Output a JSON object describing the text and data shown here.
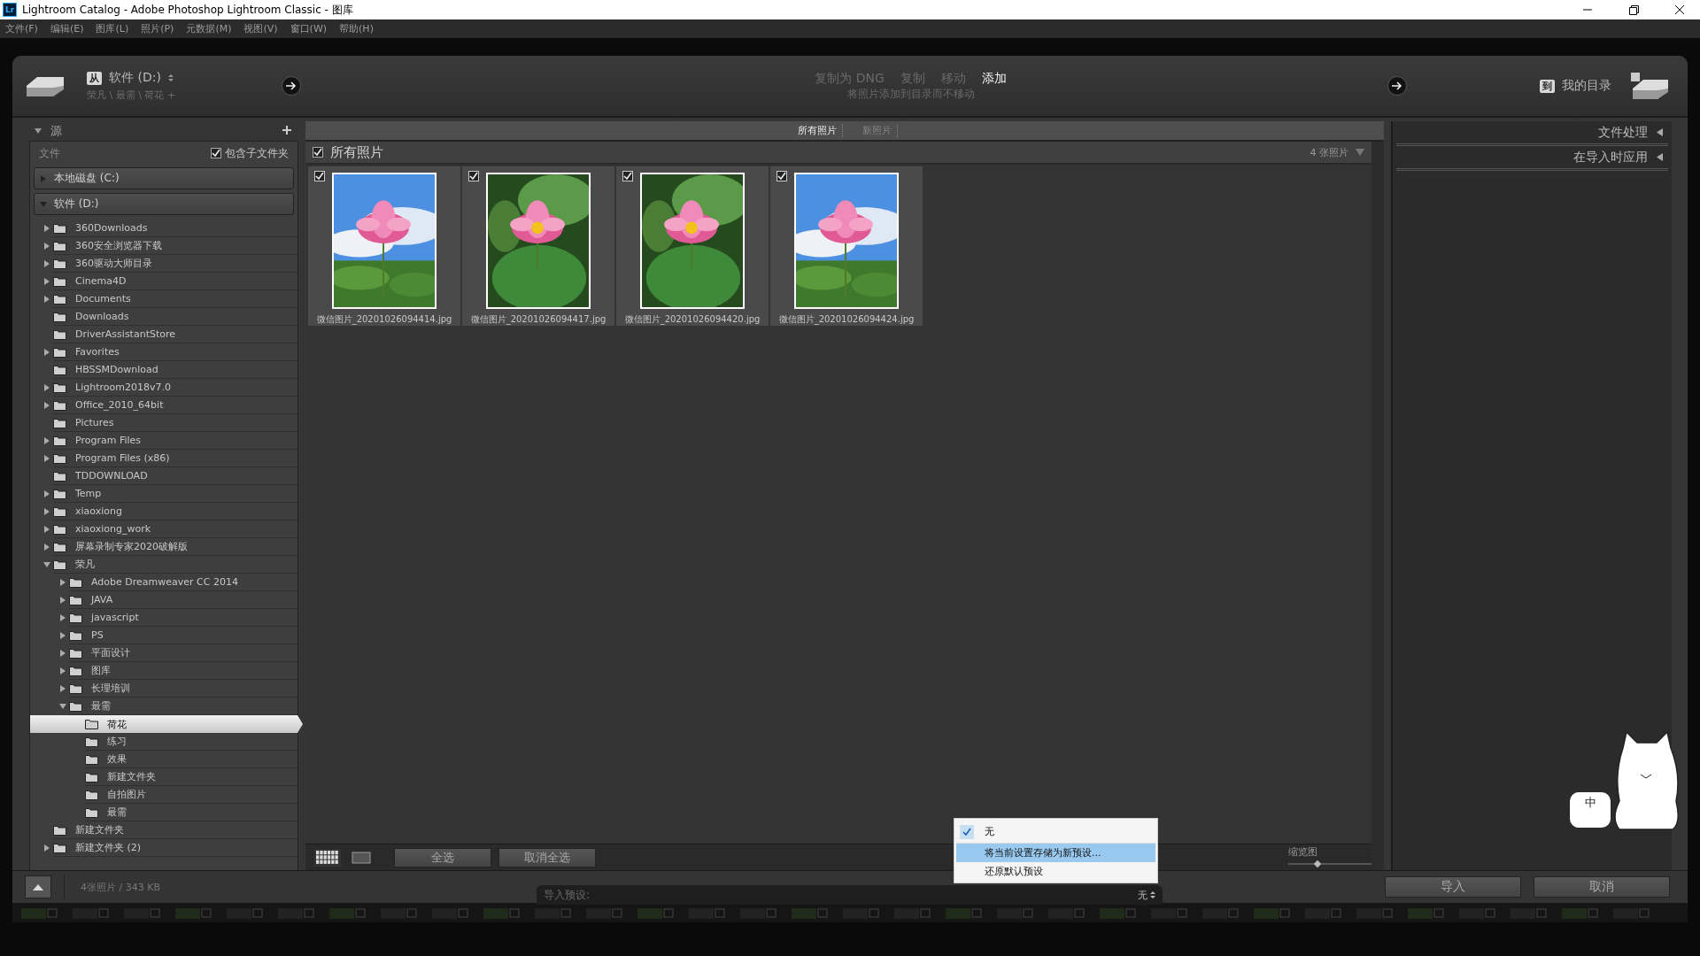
{
  "window": {
    "title": "Lightroom Catalog - Adobe Photoshop Lightroom Classic - 图库",
    "app_badge": "Lr"
  },
  "menu": [
    "文件(F)",
    "编辑(E)",
    "图库(L)",
    "照片(P)",
    "元数据(M)",
    "视图(V)",
    "窗口(W)",
    "帮助(H)"
  ],
  "header": {
    "from_badge": "从",
    "source_drive": "软件 (D:)",
    "source_path": "荣凡 \\ 最需 \\ 荷花 +",
    "modes": [
      {
        "label": "复制为 DNG",
        "selected": false
      },
      {
        "label": "复制",
        "selected": false
      },
      {
        "label": "移动",
        "selected": false
      },
      {
        "label": "添加",
        "selected": true
      }
    ],
    "mode_hint": "将照片添加到目录而不移动",
    "to_badge": "到",
    "destination": "我的目录"
  },
  "source": {
    "title": "源",
    "files_label": "文件",
    "include_subfolders": {
      "label": "包含子文件夹",
      "checked": true
    },
    "drives": [
      {
        "label": "本地磁盘 (C:)",
        "expanded": false
      },
      {
        "label": "软件 (D:)",
        "expanded": true,
        "children": [
          {
            "name": "360Downloads",
            "expandable": true,
            "expanded": false,
            "selected": false
          },
          {
            "name": "360安全浏览器下载",
            "expandable": true,
            "expanded": false,
            "selected": false
          },
          {
            "name": "360驱动大师目录",
            "expandable": true,
            "expanded": false,
            "selected": false
          },
          {
            "name": "Cinema4D",
            "expandable": true,
            "expanded": false,
            "selected": false
          },
          {
            "name": "Documents",
            "expandable": true,
            "expanded": false,
            "selected": false
          },
          {
            "name": "Downloads",
            "expandable": false,
            "selected": false
          },
          {
            "name": "DriverAssistantStore",
            "expandable": false,
            "selected": false
          },
          {
            "name": "Favorites",
            "expandable": true,
            "expanded": false,
            "selected": false
          },
          {
            "name": "HBSSMDownload",
            "expandable": false,
            "selected": false
          },
          {
            "name": "Lightroom2018v7.0",
            "expandable": true,
            "expanded": false,
            "selected": false
          },
          {
            "name": "Office_2010_64bit",
            "expandable": true,
            "expanded": false,
            "selected": false
          },
          {
            "name": "Pictures",
            "expandable": false,
            "selected": false
          },
          {
            "name": "Program Files",
            "expandable": true,
            "expanded": false,
            "selected": false
          },
          {
            "name": "Program Files (x86)",
            "expandable": true,
            "expanded": false,
            "selected": false
          },
          {
            "name": "TDDOWNLOAD",
            "expandable": false,
            "selected": false
          },
          {
            "name": "Temp",
            "expandable": true,
            "expanded": false,
            "selected": false
          },
          {
            "name": "xiaoxiong",
            "expandable": true,
            "expanded": false,
            "selected": false
          },
          {
            "name": "xiaoxiong_work",
            "expandable": true,
            "expanded": false,
            "selected": false
          },
          {
            "name": "屏幕录制专家2020破解版",
            "expandable": true,
            "expanded": false,
            "selected": false
          },
          {
            "name": "荣凡",
            "expandable": true,
            "expanded": true,
            "selected": false,
            "children": [
              {
                "name": "Adobe Dreamweaver CC 2014",
                "expandable": true,
                "expanded": false,
                "selected": false
              },
              {
                "name": "JAVA",
                "expandable": true,
                "expanded": false,
                "selected": false
              },
              {
                "name": "javascript",
                "expandable": true,
                "expanded": false,
                "selected": false
              },
              {
                "name": "PS",
                "expandable": true,
                "expanded": false,
                "selected": false
              },
              {
                "name": "平面设计",
                "expandable": true,
                "expanded": false,
                "selected": false
              },
              {
                "name": "图库",
                "expandable": true,
                "expanded": false,
                "selected": false
              },
              {
                "name": "长理培训",
                "expandable": true,
                "expanded": false,
                "selected": false
              },
              {
                "name": "最需",
                "expandable": true,
                "expanded": true,
                "selected": false,
                "children": [
                  {
                    "name": "荷花",
                    "expandable": false,
                    "selected": true
                  },
                  {
                    "name": "练习",
                    "expandable": false,
                    "selected": false
                  },
                  {
                    "name": "效果",
                    "expandable": false,
                    "selected": false
                  },
                  {
                    "name": "新建文件夹",
                    "expandable": false,
                    "selected": false
                  },
                  {
                    "name": "自拍图片",
                    "expandable": false,
                    "selected": false
                  },
                  {
                    "name": "最需",
                    "expandable": false,
                    "selected": false
                  }
                ]
              }
            ]
          },
          {
            "name": "新建文件夹",
            "expandable": false,
            "selected": false
          },
          {
            "name": "新建文件夹 (2)",
            "expandable": true,
            "expanded": false,
            "selected": false
          }
        ]
      }
    ]
  },
  "center": {
    "tabs": [
      {
        "label": "所有照片",
        "selected": true
      },
      {
        "label": "新照片",
        "selected": false
      }
    ],
    "grid_header": {
      "label": "所有照片",
      "checked": true
    },
    "count": "4 张照片",
    "photos": [
      {
        "filename": "微信图片_20201026094414.jpg",
        "checked": true
      },
      {
        "filename": "微信图片_20201026094417.jpg",
        "checked": true
      },
      {
        "filename": "微信图片_20201026094420.jpg",
        "checked": true
      },
      {
        "filename": "微信图片_20201026094424.jpg",
        "checked": true
      }
    ],
    "view_modes": [
      {
        "kind": "grid",
        "selected": true
      },
      {
        "kind": "loupe",
        "selected": false
      }
    ],
    "buttons": [
      "全选",
      "取消全选"
    ],
    "thumbnail": {
      "label": "缩览图",
      "level": 0.35
    }
  },
  "right": {
    "sections": [
      "文件处理",
      "在导入时应用"
    ]
  },
  "bottom": {
    "status": "4张照片 / 343 KB",
    "preset_label": "导入预设:",
    "preset_value": "无",
    "buttons": [
      "导入",
      "取消"
    ]
  },
  "preset_menu": [
    {
      "label": "无",
      "checked": true,
      "highlighted": false
    },
    {
      "label": "将当前设置存储为新预设...",
      "checked": false,
      "highlighted": true
    },
    {
      "label": "还原默认预设",
      "checked": false,
      "highlighted": false
    }
  ],
  "ime": {
    "label": "中"
  }
}
